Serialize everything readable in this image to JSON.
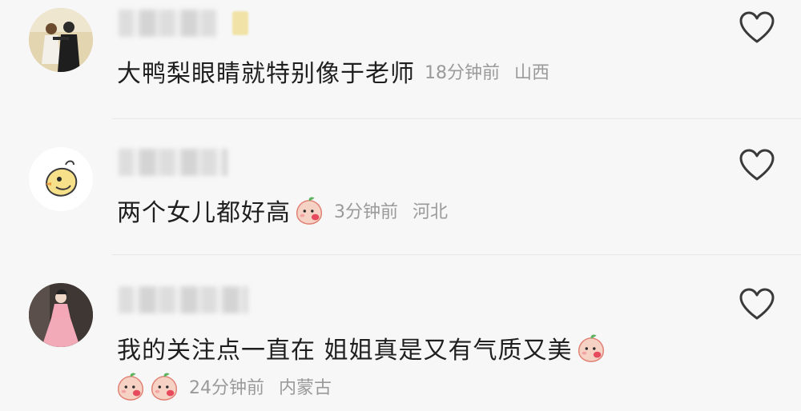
{
  "comments": [
    {
      "text": "大鸭梨眼睛就特别像于老师",
      "time": "18分钟前",
      "region": "山西",
      "emoji_after_text": 0,
      "emoji_leading_meta": 0
    },
    {
      "text": "两个女儿都好高",
      "time": "3分钟前",
      "region": "河北",
      "emoji_after_text": 1,
      "emoji_leading_meta": 0
    },
    {
      "text": "我的关注点一直在 姐姐真是又有气质又美",
      "time": "24分钟前",
      "region": "内蒙古",
      "emoji_after_text": 1,
      "emoji_leading_meta": 2
    }
  ],
  "icons": {
    "like": "heart-outline-icon",
    "emoji": "peach-blush-emoji-icon"
  },
  "colors": {
    "background": "#f7f7f7",
    "text": "#1f1f1f",
    "meta": "#9a9a9a",
    "emoji_peach": "#f6c9b9",
    "emoji_leaf": "#4caf50"
  }
}
